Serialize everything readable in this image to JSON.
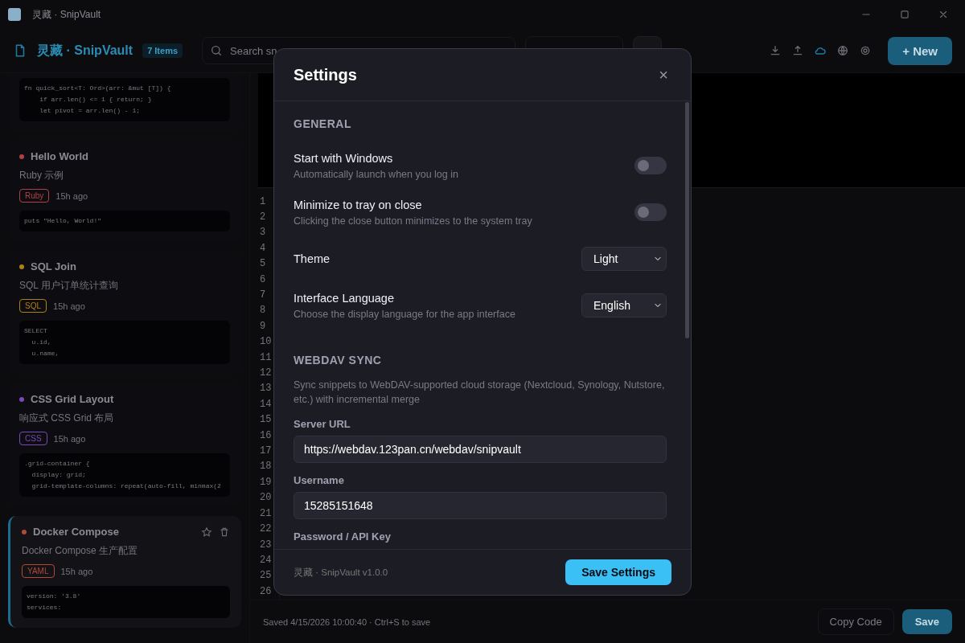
{
  "window": {
    "title": "灵藏 · SnipVault"
  },
  "toolbar": {
    "brand": "灵藏 · SnipVault",
    "count": "7 Items",
    "search_placeholder": "Search sn",
    "new_button": "+ New"
  },
  "snippets": [
    {
      "kind": "code_only",
      "code": [
        "fn quick_sort<T: Ord>(arr: &mut [T]) {",
        "    if arr.len() <= 1 { return; }",
        "    let pivot = arr.len() - 1;"
      ],
      "selected": false
    },
    {
      "kind": "card",
      "title": "Hello World",
      "description": "Ruby 示例",
      "language": "Ruby",
      "color": "#b04048",
      "age": "15h ago",
      "code": [
        "puts \"Hello, World!\""
      ],
      "selected": false
    },
    {
      "kind": "card",
      "title": "SQL Join",
      "description": "SQL 用户订单统计查询",
      "language": "SQL",
      "color": "#b08018",
      "age": "15h ago",
      "code": [
        "SELECT",
        "  u.id,",
        "  u.name,"
      ],
      "selected": false
    },
    {
      "kind": "card",
      "title": "CSS Grid Layout",
      "description": "响应式 CSS Grid 布局",
      "language": "CSS",
      "color": "#7a48b8",
      "age": "15h ago",
      "code": [
        ".grid-container {",
        "  display: grid;",
        "  grid-template-columns: repeat(auto-fill, minmax(2"
      ],
      "selected": false
    },
    {
      "kind": "card",
      "title": "Docker Compose",
      "description": "Docker Compose 生产配置",
      "language": "YAML",
      "color": "#b04a38",
      "age": "15h ago",
      "code": [
        "version: '3.8'",
        "services:"
      ],
      "selected": true
    }
  ],
  "editor": {
    "line_numbers": [
      "1",
      "2",
      "3",
      "4",
      "5",
      "6",
      "7",
      "8",
      "9",
      "10",
      "11",
      "12",
      "13",
      "14",
      "15",
      "16",
      "17",
      "18",
      "19",
      "20",
      "21",
      "22",
      "23",
      "24",
      "25",
      "26"
    ],
    "status": "Saved 4/15/2026 10:00:40 · Ctrl+S to save",
    "copy_button": "Copy Code",
    "save_button": "Save"
  },
  "settings": {
    "title": "Settings",
    "close": "×",
    "sections": [
      {
        "heading": "GENERAL",
        "rows": [
          {
            "kind": "toggle",
            "label": "Start with Windows",
            "description": "Automatically launch when you log in",
            "on": false
          },
          {
            "kind": "toggle",
            "label": "Minimize to tray on close",
            "description": "Clicking the close button minimizes to the system tray",
            "on": false
          },
          {
            "kind": "select",
            "label": "Theme",
            "value": "Light"
          },
          {
            "kind": "select",
            "label": "Interface Language",
            "description": "Choose the display language for the app interface",
            "value": "English"
          }
        ]
      },
      {
        "heading": "WEBDAV SYNC",
        "description": "Sync snippets to WebDAV-supported cloud storage (Nextcloud, Synology, Nutstore, etc.) with incremental merge",
        "rows": [
          {
            "kind": "field",
            "label": "Server URL",
            "value": "https://webdav.123pan.cn/webdav/snipvault"
          },
          {
            "kind": "field",
            "label": "Username",
            "value": "15285151648"
          },
          {
            "kind": "field",
            "label": "Password / API Key"
          }
        ]
      }
    ],
    "version": "灵藏 · SnipVault v1.0.0",
    "save_button": "Save Settings"
  }
}
